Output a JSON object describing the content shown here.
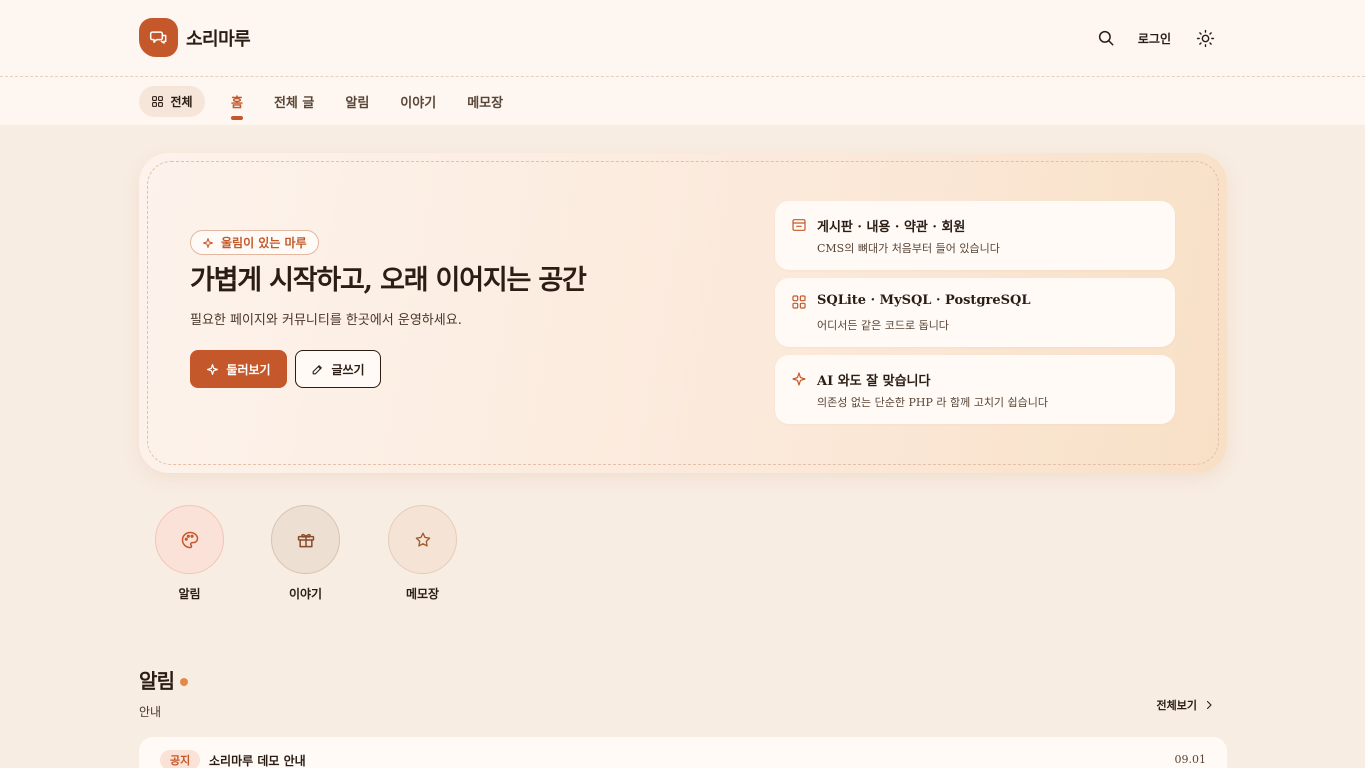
{
  "header": {
    "brand": "소리마루",
    "login_label": "로그인"
  },
  "nav": {
    "all_label": "전체",
    "tabs": [
      {
        "label": "홈",
        "active": true
      },
      {
        "label": "전체 글",
        "active": false
      },
      {
        "label": "알림",
        "active": false
      },
      {
        "label": "이야기",
        "active": false
      },
      {
        "label": "메모장",
        "active": false
      }
    ]
  },
  "hero": {
    "badge": "울림이 있는 마루",
    "title": "가볍게 시작하고, 오래 이어지는 공간",
    "subtitle": "필요한 페이지와 커뮤니티를 한곳에서 운영하세요.",
    "primary_button": "둘러보기",
    "secondary_button": "글쓰기",
    "features": [
      {
        "icon": "board-icon",
        "title": "게시판 · 내용 · 약관 · 회원",
        "desc": "CMS의 뼈대가 처음부터 들어 있습니다"
      },
      {
        "icon": "grid-icon",
        "title": "SQLite · MySQL · PostgreSQL",
        "desc": "어디서든 같은 코드로 돕니다"
      },
      {
        "icon": "sparkle-icon",
        "title": "AI 와도 잘 맞습니다",
        "desc": "의존성 없는 단순한 PHP 라 함께 고치기 쉽습니다"
      }
    ]
  },
  "quick_links": [
    {
      "label": "알림",
      "icon": "palette-icon",
      "bg": "#fbe2d9"
    },
    {
      "label": "이야기",
      "icon": "gift-icon",
      "bg": "#eedfd3"
    },
    {
      "label": "메모장",
      "icon": "star-icon",
      "bg": "#f5e4d6"
    }
  ],
  "section": {
    "title": "알림",
    "subtitle": "안내",
    "see_all": "전체보기",
    "posts": [
      {
        "tag": "공지",
        "title": "소리마루 데모 안내",
        "date": "09.01"
      }
    ]
  },
  "colors": {
    "accent": "#c4582b",
    "background": "#f8ede3",
    "text": "#2b1d14"
  }
}
